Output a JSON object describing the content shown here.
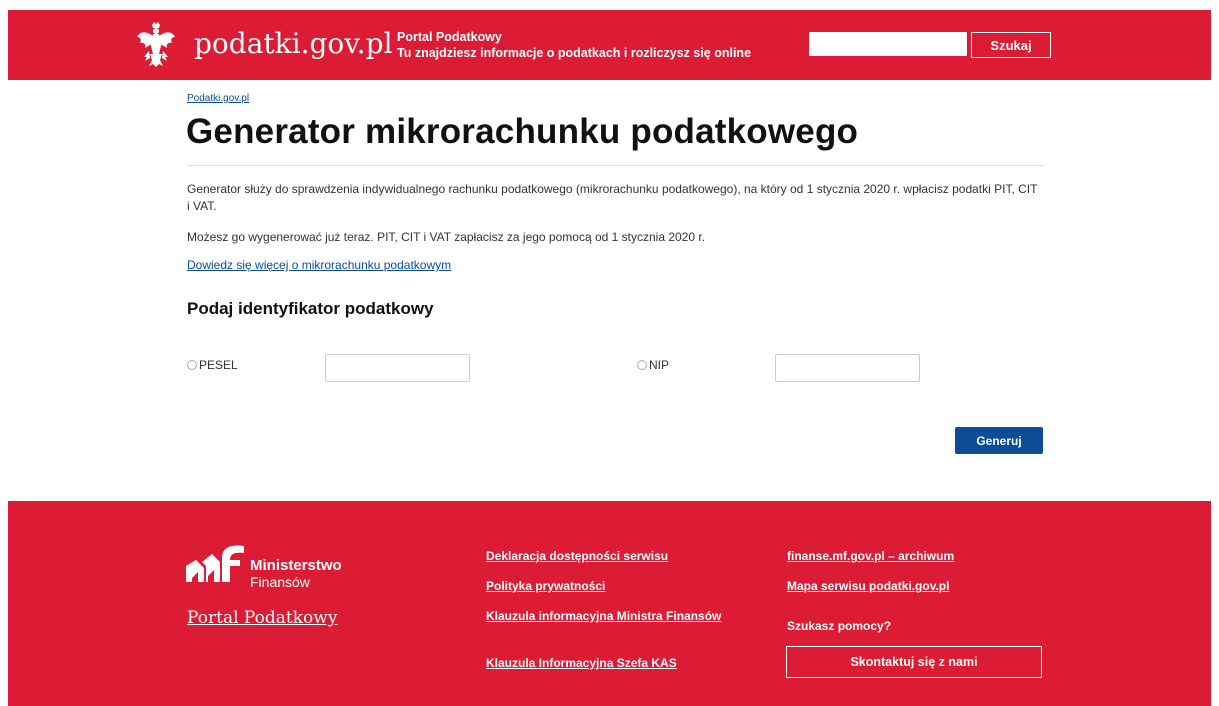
{
  "header": {
    "site_name": "podatki.gov.pl",
    "portal_title": "Portal Podatkowy",
    "portal_subtitle": "Tu znajdziesz informacje o podatkach i rozliczysz się online",
    "search_button": "Szukaj",
    "search_value": ""
  },
  "breadcrumb": "Podatki.gov.pl",
  "main": {
    "title": "Generator mikrorachunku podatkowego",
    "intro": "Generator służy do sprawdzenia indywidualnego rachunku podatkowego (mikrorachunku podatkowego), na który od 1 stycznia 2020 r. wpłacisz podatki PIT, CIT i VAT.",
    "intro2": "Możesz go wygenerować już teraz. PIT, CIT i VAT zapłacisz za jego pomocą od 1 stycznia 2020 r.",
    "more_link": "Dowiedz się więcej o mikrorachunku podatkowym",
    "section_title": "Podaj identyfikator podatkowy",
    "pesel_label": "PESEL",
    "nip_label": "NIP",
    "pesel_value": "",
    "nip_value": "",
    "generate_button": "Generuj"
  },
  "footer": {
    "ministry_line1": "Ministerstwo",
    "ministry_line2": "Finansów",
    "portal_link": "Portal Podatkowy",
    "links_col1": [
      "Deklaracja dostępności serwisu",
      "Polityka prywatności",
      "Klauzula informacyjna Ministra Finansów",
      "Klauzula Informacyjna Szefa KAS"
    ],
    "links_col2": [
      "finanse.mf.gov.pl – archiwum",
      "Mapa serwisu podatki.gov.pl"
    ],
    "help_text": "Szukasz pomocy?",
    "contact_button": "Skontaktuj się z nami"
  },
  "colors": {
    "brand_red": "#dc1b34",
    "link_blue": "#0a4c9c",
    "button_blue": "#0d4d97"
  },
  "icons": {
    "logo": "polish-eagle-icon",
    "ministry_logo": "mf-logo-icon"
  }
}
